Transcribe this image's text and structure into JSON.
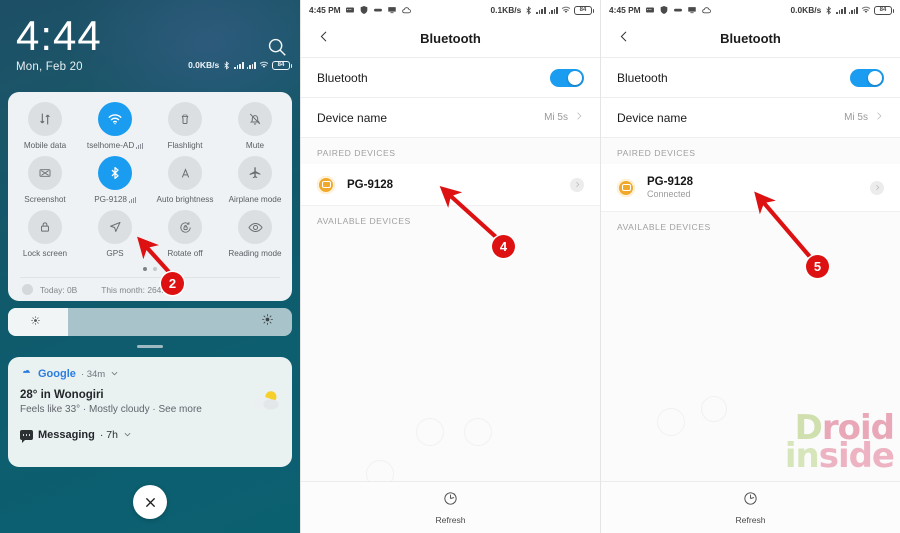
{
  "panel_lockscreen": {
    "name": "notification-shade",
    "clock": "4:44",
    "date": "Mon, Feb 20",
    "status": {
      "net_speed": "0.0KB/s",
      "battery_percent": "84"
    },
    "quick_settings": {
      "tiles": [
        {
          "label": "Mobile data",
          "icon": "mobile-data-icon",
          "active": false,
          "signal": false
        },
        {
          "label": "tselhome-AD",
          "icon": "wifi-icon",
          "active": true,
          "signal": true
        },
        {
          "label": "Flashlight",
          "icon": "flashlight-icon",
          "active": false,
          "signal": false
        },
        {
          "label": "Mute",
          "icon": "mute-bell-icon",
          "active": false,
          "signal": false
        },
        {
          "label": "Screenshot",
          "icon": "screenshot-icon",
          "active": false,
          "signal": false
        },
        {
          "label": "PG-9128",
          "icon": "bluetooth-icon",
          "active": true,
          "signal": true
        },
        {
          "label": "Auto brightness",
          "icon": "auto-brightness-icon",
          "active": false,
          "signal": false
        },
        {
          "label": "Airplane mode",
          "icon": "airplane-icon",
          "active": false,
          "signal": false
        },
        {
          "label": "Lock screen",
          "icon": "lock-icon",
          "active": false,
          "signal": false
        },
        {
          "label": "GPS",
          "icon": "gps-arrow-icon",
          "active": false,
          "signal": false
        },
        {
          "label": "Rotate off",
          "icon": "rotate-lock-icon",
          "active": false,
          "signal": false
        },
        {
          "label": "Reading mode",
          "icon": "eye-icon",
          "active": false,
          "signal": false
        }
      ],
      "page_dots": 2,
      "active_dot": 0,
      "data_usage_today": "Today: 0B",
      "data_usage_month": "This month: 264.8MB"
    },
    "brightness": {
      "label": "brightness-slider",
      "fill_percent": 21
    },
    "notifications": [
      {
        "source": "Google",
        "time": "· 34m",
        "title": "28° in Wonogiri",
        "subtitle": "Feels like 33° · Mostly cloudy · See more"
      },
      {
        "source": "Messaging",
        "time": "· 7h",
        "title": "",
        "subtitle": ""
      }
    ],
    "close_button": "×"
  },
  "panel_bluetooth_paired": {
    "status": {
      "time": "4:45 PM",
      "net_speed": "0.1KB/s",
      "battery_percent": "84",
      "icons": [
        "messaging-icon",
        "shield-icon",
        "capsule-icon",
        "monitor-icon",
        "cloud-icon"
      ]
    },
    "appbar": {
      "back": "‹",
      "title": "Bluetooth"
    },
    "rows": [
      {
        "label": "Bluetooth",
        "control": "toggle",
        "toggle_on": true
      },
      {
        "label": "Device name",
        "value": "Mi 5s",
        "control": "chevron"
      }
    ],
    "sections": [
      {
        "header": "PAIRED DEVICES",
        "devices": [
          {
            "name": "PG-9128",
            "status": ""
          }
        ]
      },
      {
        "header": "AVAILABLE DEVICES",
        "devices": []
      }
    ],
    "bottom_action": {
      "label": "Refresh",
      "icon": "refresh-icon"
    }
  },
  "panel_bluetooth_connected": {
    "status": {
      "time": "4:45 PM",
      "net_speed": "0.0KB/s",
      "battery_percent": "84",
      "icons": [
        "messaging-icon",
        "shield-icon",
        "capsule-icon",
        "monitor-icon",
        "cloud-icon"
      ]
    },
    "appbar": {
      "back": "‹",
      "title": "Bluetooth"
    },
    "rows": [
      {
        "label": "Bluetooth",
        "control": "toggle",
        "toggle_on": true
      },
      {
        "label": "Device name",
        "value": "Mi 5s",
        "control": "chevron"
      }
    ],
    "sections": [
      {
        "header": "PAIRED DEVICES",
        "devices": [
          {
            "name": "PG-9128",
            "status": "Connected"
          }
        ]
      },
      {
        "header": "AVAILABLE DEVICES",
        "devices": []
      }
    ],
    "watermark": {
      "line1_a": "D",
      "line1_b": "roid",
      "line2_a": "in",
      "line2_b": "side"
    },
    "bottom_action": {
      "label": "Refresh",
      "icon": "refresh-icon"
    }
  },
  "annotations": {
    "colors": {
      "marker": "#dd1111"
    },
    "steps": [
      {
        "number": "2",
        "target": "quick-settings-tile-bluetooth"
      },
      {
        "number": "4",
        "target": "paired-device-pg9128"
      },
      {
        "number": "5",
        "target": "paired-device-pg9128-connected"
      }
    ]
  }
}
